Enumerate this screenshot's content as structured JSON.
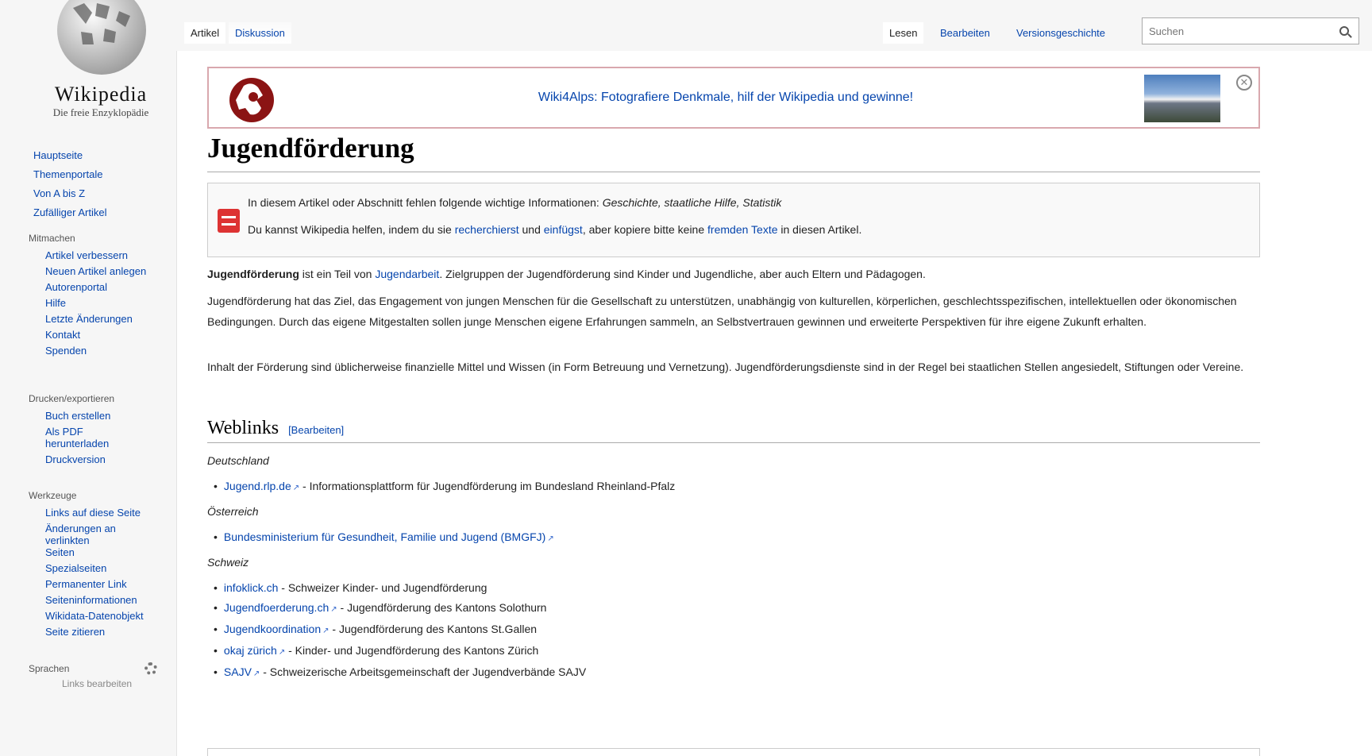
{
  "logo": {
    "wordmark": "Wikipedia",
    "tagline": "Die freie Enzyklopädie"
  },
  "nav": {
    "main": [
      "Hauptseite",
      "Themenportale",
      "Von A bis Z",
      "Zufälliger Artikel"
    ],
    "mitmachen": {
      "heading": "Mitmachen",
      "items": [
        "Artikel verbessern",
        "Neuen Artikel anlegen",
        "Autorenportal",
        "Hilfe",
        "Letzte Änderungen",
        "Kontakt",
        "Spenden"
      ]
    },
    "drucken": {
      "heading": "Drucken/exportieren",
      "items": [
        "Buch erstellen",
        "Als PDF herunterladen",
        "Druckversion"
      ]
    },
    "werkzeuge": {
      "heading": "Werkzeuge",
      "items": [
        "Links auf diese Seite",
        "Änderungen an verlinkten Seiten",
        "Spezialseiten",
        "Permanenter Link",
        "Seiteninformationen",
        "Wikidata-Datenobjekt",
        "Seite zitieren"
      ]
    },
    "sprachen": {
      "heading": "Sprachen",
      "edit_links": "Links bearbeiten"
    }
  },
  "tabs": {
    "artikel": "Artikel",
    "diskussion": "Diskussion",
    "lesen": "Lesen",
    "bearbeiten": "Bearbeiten",
    "versionsgeschichte": "Versionsgeschichte"
  },
  "search": {
    "placeholder": "Suchen"
  },
  "banner": {
    "text": "Wiki4Alps: Fotografiere Denkmale, hilf der Wikipedia und gewinne!"
  },
  "article": {
    "title": "Jugendförderung",
    "notice": {
      "line1_pre": "In diesem Artikel oder Abschnitt fehlen folgende wichtige Informationen: ",
      "line1_topics": "Geschichte, staatliche Hilfe, Statistik",
      "line2_a": "Du kannst Wikipedia helfen, indem du sie ",
      "link_recherchierst": "recherchierst",
      "line2_b": " und ",
      "link_einfuegst": "einfügst",
      "line2_c": ", aber kopiere bitte keine ",
      "link_fremden": "fremden Texte",
      "line2_d": " in diesen Artikel."
    },
    "para1": {
      "bold": "Jugendförderung",
      "a": " ist ein Teil von ",
      "link": "Jugendarbeit",
      "b": ". Zielgruppen der Jugendförderung sind Kinder und Jugendliche, aber auch Eltern und Pädagogen."
    },
    "para2": "Jugendförderung hat das Ziel, das Engagement von jungen Menschen für die Gesellschaft zu unterstützen, unabhängig von kulturellen, körperlichen, geschlechtsspezifischen, intellektuellen oder ökonomischen Bedingungen. Durch das eigene Mitgestalten sollen junge Menschen eigene Erfahrungen sammeln, an Selbstvertrauen gewinnen und erweiterte Perspektiven für ihre eigene Zukunft erhalten.",
    "para3": "Inhalt der Förderung sind üblicherweise finanzielle Mittel und Wissen (in Form Betreuung und Vernetzung). Jugendförderungsdienste sind in der Regel bei staatlichen Stellen angesiedelt, Stiftungen oder Vereine.",
    "weblinks": {
      "title": "Weblinks",
      "edit": "[Bearbeiten]",
      "deutschland": {
        "label": "Deutschland",
        "links": [
          {
            "link": "Jugend.rlp.de",
            "desc": " - Informationsplattform für Jugendförderung im Bundesland Rheinland-Pfalz"
          }
        ]
      },
      "oesterreich": {
        "label": "Österreich",
        "links": [
          {
            "link": "Bundesministerium für Gesundheit, Familie und Jugend (BMGFJ)",
            "desc": ""
          }
        ]
      },
      "schweiz": {
        "label": "Schweiz",
        "links": [
          {
            "link": "infoklick.ch",
            "desc": " - Schweizer Kinder- und Jugendförderung"
          },
          {
            "link": "Jugendfoerderung.ch",
            "desc": " - Jugendförderung des Kantons Solothurn"
          },
          {
            "link": "Jugendkoordination",
            "desc": " - Jugendförderung des Kantons St.Gallen"
          },
          {
            "link": "okaj zürich",
            "desc": " - Kinder- und Jugendförderung des Kantons Zürich"
          },
          {
            "link": "SAJV",
            "desc": " - Schweizerische Arbeitsgemeinschaft der Jugendverbände SAJV"
          }
        ]
      }
    }
  }
}
